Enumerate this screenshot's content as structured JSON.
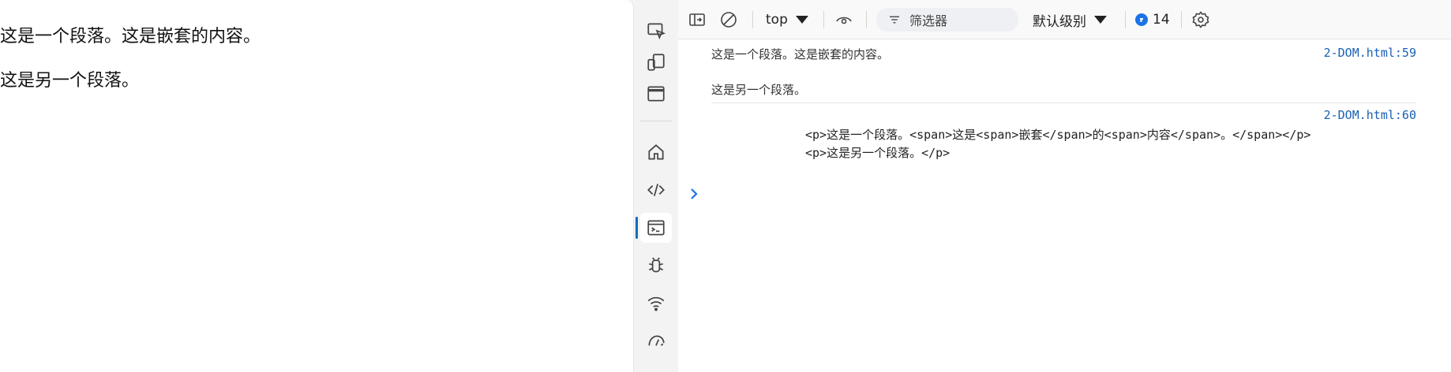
{
  "page": {
    "paragraph1": "这是一个段落。这是嵌套的内容。",
    "paragraph2": "这是另一个段落。"
  },
  "activity_bar": {
    "items": [
      {
        "icon": "inspect-icon"
      },
      {
        "icon": "device-emulation-icon"
      },
      {
        "icon": "window-icon"
      },
      {
        "icon": "home-icon"
      },
      {
        "icon": "elements-code-icon"
      },
      {
        "icon": "console-icon",
        "active": true
      },
      {
        "icon": "bug-icon"
      },
      {
        "icon": "network-wifi-icon"
      },
      {
        "icon": "performance-gauge-icon"
      }
    ]
  },
  "toolbar": {
    "context": "top",
    "filter_placeholder": "筛选器",
    "level": "默认级别",
    "message_count": "14"
  },
  "console": {
    "messages": [
      {
        "lines": [
          "这是一个段落。这是嵌套的内容。",
          "这是另一个段落。"
        ],
        "source": "2-DOM.html:59"
      },
      {
        "lines": [
          "<p>这是一个段落。<span>这是<span>嵌套</span>的<span>内容</span>。</span></p>",
          "<p>这是另一个段落。</p>"
        ],
        "source": "2-DOM.html:60"
      }
    ]
  },
  "colors": {
    "accent": "#0f6cbd",
    "link": "#1a5fb4",
    "badge": "#1a73e8"
  }
}
